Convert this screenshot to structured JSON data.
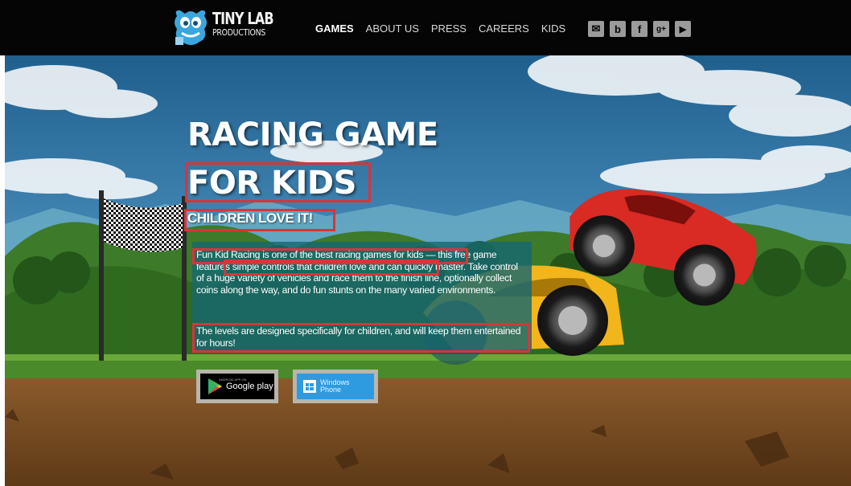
{
  "header": {
    "logo": {
      "line1": "TINY LAB",
      "line2": "PRODUCTIONS"
    },
    "nav": [
      {
        "label": "GAMES",
        "active": true
      },
      {
        "label": "ABOUT US",
        "active": false
      },
      {
        "label": "PRESS",
        "active": false
      },
      {
        "label": "CAREERS",
        "active": false
      },
      {
        "label": "KIDS",
        "active": false
      }
    ],
    "social": [
      {
        "icon": "mail-icon",
        "glyph": "✉"
      },
      {
        "icon": "blog-icon",
        "glyph": "b"
      },
      {
        "icon": "facebook-icon",
        "glyph": "f"
      },
      {
        "icon": "google-plus-icon",
        "glyph": "g+"
      },
      {
        "icon": "youtube-icon",
        "glyph": "▶"
      }
    ]
  },
  "hero": {
    "title_line1": "RACING GAME",
    "title_line2": "FOR KIDS",
    "subtitle": "CHILDREN LOVE IT!",
    "paragraph1": "Fun Kid Racing is one of the best racing games for kids — this free game features simple controls that children love and can quickly master. Take control of a huge variety of vehicles and race them to the finish line, optionally collect coins along the way, and do fun stunts on the many varied environments.",
    "paragraph2": "The levels are designed specifically for children, and will keep them entertained for hours!",
    "buttons": {
      "google_play": {
        "small": "ANDROID APP ON",
        "label": "Google play"
      },
      "windows_phone": {
        "label": "Windows\nPhone"
      }
    }
  },
  "colors": {
    "header_bg": "#050505",
    "highlight": "#d8343a",
    "text_panel": "#166870",
    "windows_blue": "#2e9be0"
  }
}
